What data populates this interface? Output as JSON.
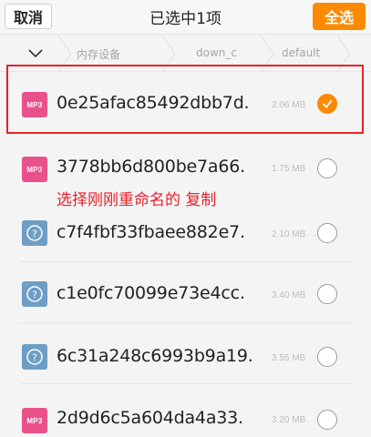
{
  "header": {
    "cancel_label": "取消",
    "title": "已选中1项",
    "select_all_label": "全选"
  },
  "breadcrumb": {
    "items": [
      "内存设备",
      "down_c",
      "default"
    ]
  },
  "files": [
    {
      "name": "0e25afac85492dbb7d.",
      "type": "mp3",
      "type_label": "MP3",
      "size": "2.06 MB",
      "selected": true
    },
    {
      "name": "3778bb6d800be7a66.",
      "type": "mp3",
      "type_label": "MP3",
      "size": "1.75 MB",
      "selected": false
    },
    {
      "name": "c7f4fbf33fbaee882e7.",
      "type": "unknown",
      "type_label": "?",
      "size": "2.10 MB",
      "selected": false
    },
    {
      "name": "c1e0fc70099e73e4cc.",
      "type": "unknown",
      "type_label": "?",
      "size": "3.40 MB",
      "selected": false
    },
    {
      "name": "6c31a248c6993b9a19.",
      "type": "unknown",
      "type_label": "?",
      "size": "3.55 MB",
      "selected": false
    },
    {
      "name": "2d9d6c5a604da4a33.",
      "type": "mp3",
      "type_label": "MP3",
      "size": "3.20 MB",
      "selected": false
    }
  ],
  "annotation": {
    "text": "选择刚刚重命名的 复制",
    "color": "#e8202a"
  },
  "colors": {
    "accent": "#fc8a00",
    "mp3": "#e9518a",
    "unknown": "#6d9ec5",
    "highlight": "#e8202a"
  }
}
